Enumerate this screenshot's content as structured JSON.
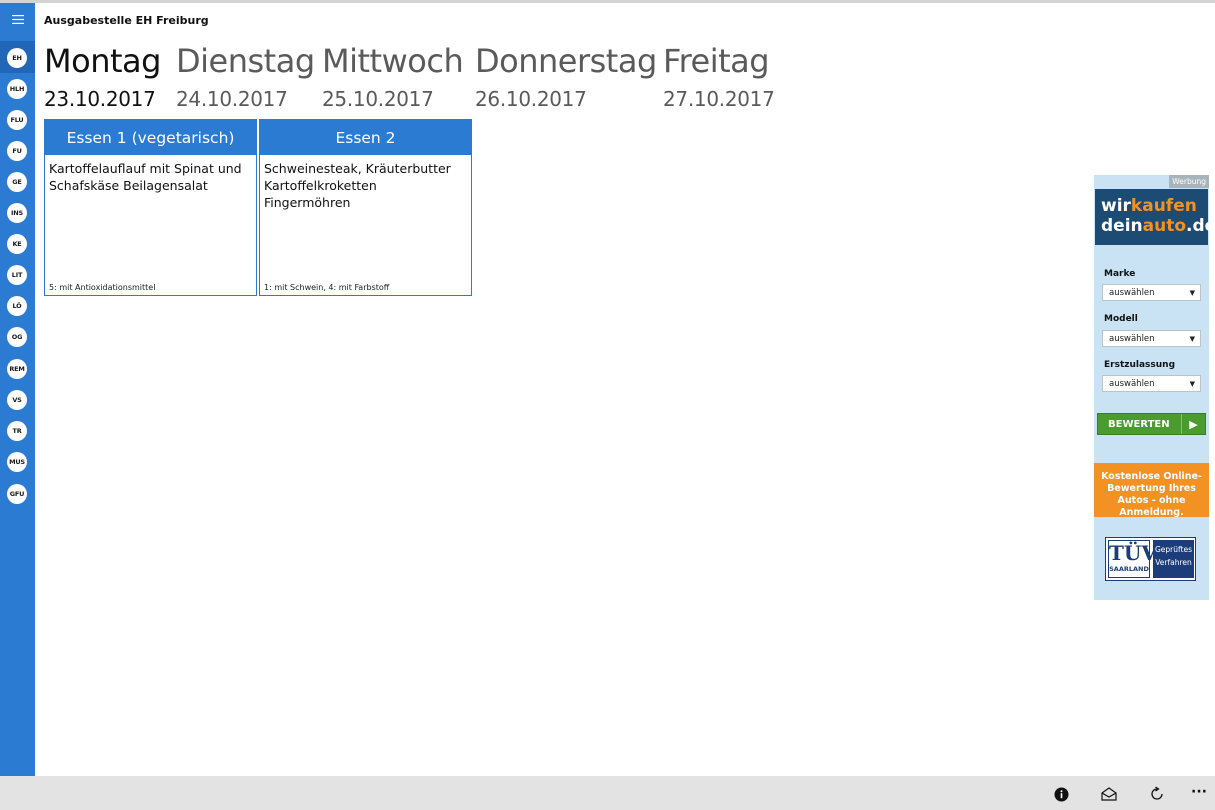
{
  "app": {
    "title": "Ausgabestelle EH Freiburg"
  },
  "sidebar": {
    "items": [
      {
        "label": "EH",
        "selected": true
      },
      {
        "label": "HLH"
      },
      {
        "label": "FLU"
      },
      {
        "label": "FU"
      },
      {
        "label": "GE"
      },
      {
        "label": "INS"
      },
      {
        "label": "KE"
      },
      {
        "label": "LIT"
      },
      {
        "label": "LÖ"
      },
      {
        "label": "OG"
      },
      {
        "label": "REM"
      },
      {
        "label": "VS"
      },
      {
        "label": "TR"
      },
      {
        "label": "MUS"
      },
      {
        "label": "GFU"
      }
    ]
  },
  "days": [
    {
      "name": "Montag",
      "date": "23.10.2017",
      "active": true
    },
    {
      "name": "Dienstag",
      "date": "24.10.2017"
    },
    {
      "name": "Mittwoch",
      "date": "25.10.2017"
    },
    {
      "name": "Donnerstag",
      "date": "26.10.2017"
    },
    {
      "name": "Freitag",
      "date": "27.10.2017"
    }
  ],
  "meals": [
    {
      "title": "Essen 1 (vegetarisch)",
      "description": "Kartoffelauflauf mit Spinat und Schafskäse Beilagensalat",
      "additives": "5: mit Antioxidationsmittel"
    },
    {
      "title": "Essen 2",
      "description": "Schweinesteak, Kräuterbutter Kartoffelkroketten Fingermöhren",
      "additives": "1: mit Schwein, 4: mit Farbstoff"
    }
  ],
  "ad": {
    "tag": "Werbung",
    "logo_part1": "wir",
    "logo_part2": "kaufen",
    "logo_part3": "dein",
    "logo_part4": "auto",
    "logo_part5": ".de",
    "fields": [
      {
        "label": "Marke",
        "value": "auswählen"
      },
      {
        "label": "Modell",
        "value": "auswählen"
      },
      {
        "label": "Erstzulassung",
        "value": "auswählen"
      }
    ],
    "button": "BEWERTEN",
    "promo": "Kostenlose Online-Bewertung Ihres Autos - ohne Anmeldung.",
    "tuv_brand": "TÜV",
    "tuv_region": "SAARLAND",
    "tuv_text": "Geprüftes Verfahren"
  },
  "bottombar": {
    "icons": [
      "info-icon",
      "mail-icon",
      "refresh-icon",
      "more-icon"
    ],
    "more_label": "···"
  },
  "colors": {
    "accent": "#2b7bd3",
    "ad_navy": "#1c4c73",
    "ad_orange": "#f39223",
    "ad_green": "#4a9c2f"
  }
}
